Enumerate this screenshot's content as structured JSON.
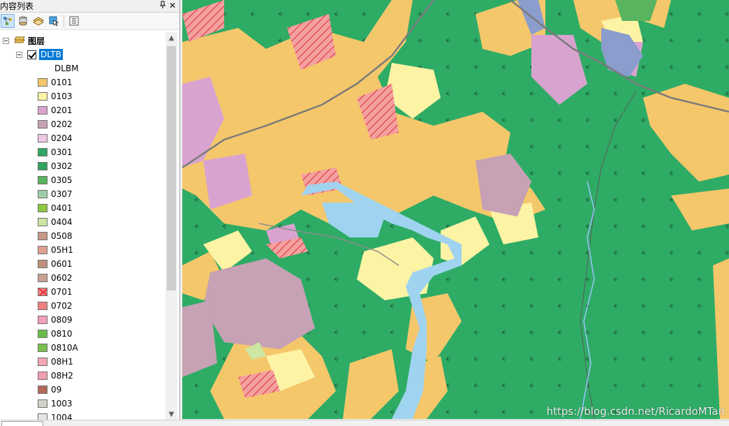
{
  "panel": {
    "title": "内容列表",
    "pin_glyph": "ᵖ",
    "close_glyph": "✕"
  },
  "toolbar": {
    "buttons": [
      "list-by-drawing-order-icon",
      "list-by-source-icon",
      "list-by-visibility-icon",
      "list-by-selection-icon",
      "options-icon"
    ]
  },
  "tree": {
    "root_label": "图层",
    "layer_name": "DLTB",
    "field_name": "DLBM",
    "legend": [
      {
        "code": "0101",
        "color": "#f5c76b",
        "hatch": false
      },
      {
        "code": "0103",
        "color": "#fcf3a4",
        "hatch": false
      },
      {
        "code": "0201",
        "color": "#d9a3cf",
        "hatch": false
      },
      {
        "code": "0202",
        "color": "#c7a1b4",
        "hatch": false
      },
      {
        "code": "0204",
        "color": "#f0c8e6",
        "hatch": false
      },
      {
        "code": "0301",
        "color": "#2ea863",
        "hatch": false
      },
      {
        "code": "0302",
        "color": "#31a35f",
        "hatch": false
      },
      {
        "code": "0305",
        "color": "#58b45e",
        "hatch": false
      },
      {
        "code": "0307",
        "color": "#9ccfa8",
        "hatch": false
      },
      {
        "code": "0401",
        "color": "#8ec63f",
        "hatch": false
      },
      {
        "code": "0404",
        "color": "#cde6a3",
        "hatch": false
      },
      {
        "code": "0508",
        "color": "#c79a87",
        "hatch": false
      },
      {
        "code": "05H1",
        "color": "#e0a08f",
        "hatch": false
      },
      {
        "code": "0601",
        "color": "#c2917e",
        "hatch": false
      },
      {
        "code": "0602",
        "color": "#c9a192",
        "hatch": false
      },
      {
        "code": "0701",
        "color": "#f08080",
        "hatch": true
      },
      {
        "code": "0702",
        "color": "#f28080",
        "hatch": false
      },
      {
        "code": "0809",
        "color": "#f2a0b8",
        "hatch": false
      },
      {
        "code": "0810",
        "color": "#6bbd4a",
        "hatch": false
      },
      {
        "code": "0810A",
        "color": "#7ac04e",
        "hatch": false
      },
      {
        "code": "08H1",
        "color": "#f4a6b4",
        "hatch": false
      },
      {
        "code": "08H2",
        "color": "#f2a0b0",
        "hatch": false
      },
      {
        "code": "09",
        "color": "#b5695a",
        "hatch": false
      },
      {
        "code": "1003",
        "color": "#d2d2c8",
        "hatch": false
      },
      {
        "code": "1004",
        "color": "#e6e6e6",
        "hatch": false
      }
    ]
  },
  "map": {
    "watermark": "https://blog.csdn.net/RicardoMTan"
  }
}
